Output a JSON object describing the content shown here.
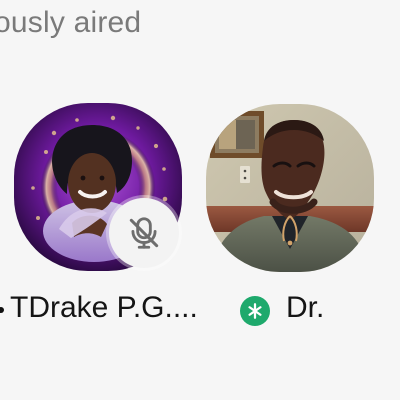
{
  "section": {
    "title": "ously aired"
  },
  "speakers": [
    {
      "name": "TDrake P.G....",
      "avatar_icon": "speaker-avatar",
      "badge_icon": "microphone-off-icon"
    },
    {
      "name": "Dr.",
      "avatar_icon": "speaker-avatar",
      "badge_icon": "snowflake-status-icon"
    }
  ],
  "colors": {
    "background": "#f6f6f6",
    "title": "#7a7a7a",
    "name": "#151515",
    "status_green": "#1ea96c",
    "mute_badge": "#f3f3f3"
  }
}
